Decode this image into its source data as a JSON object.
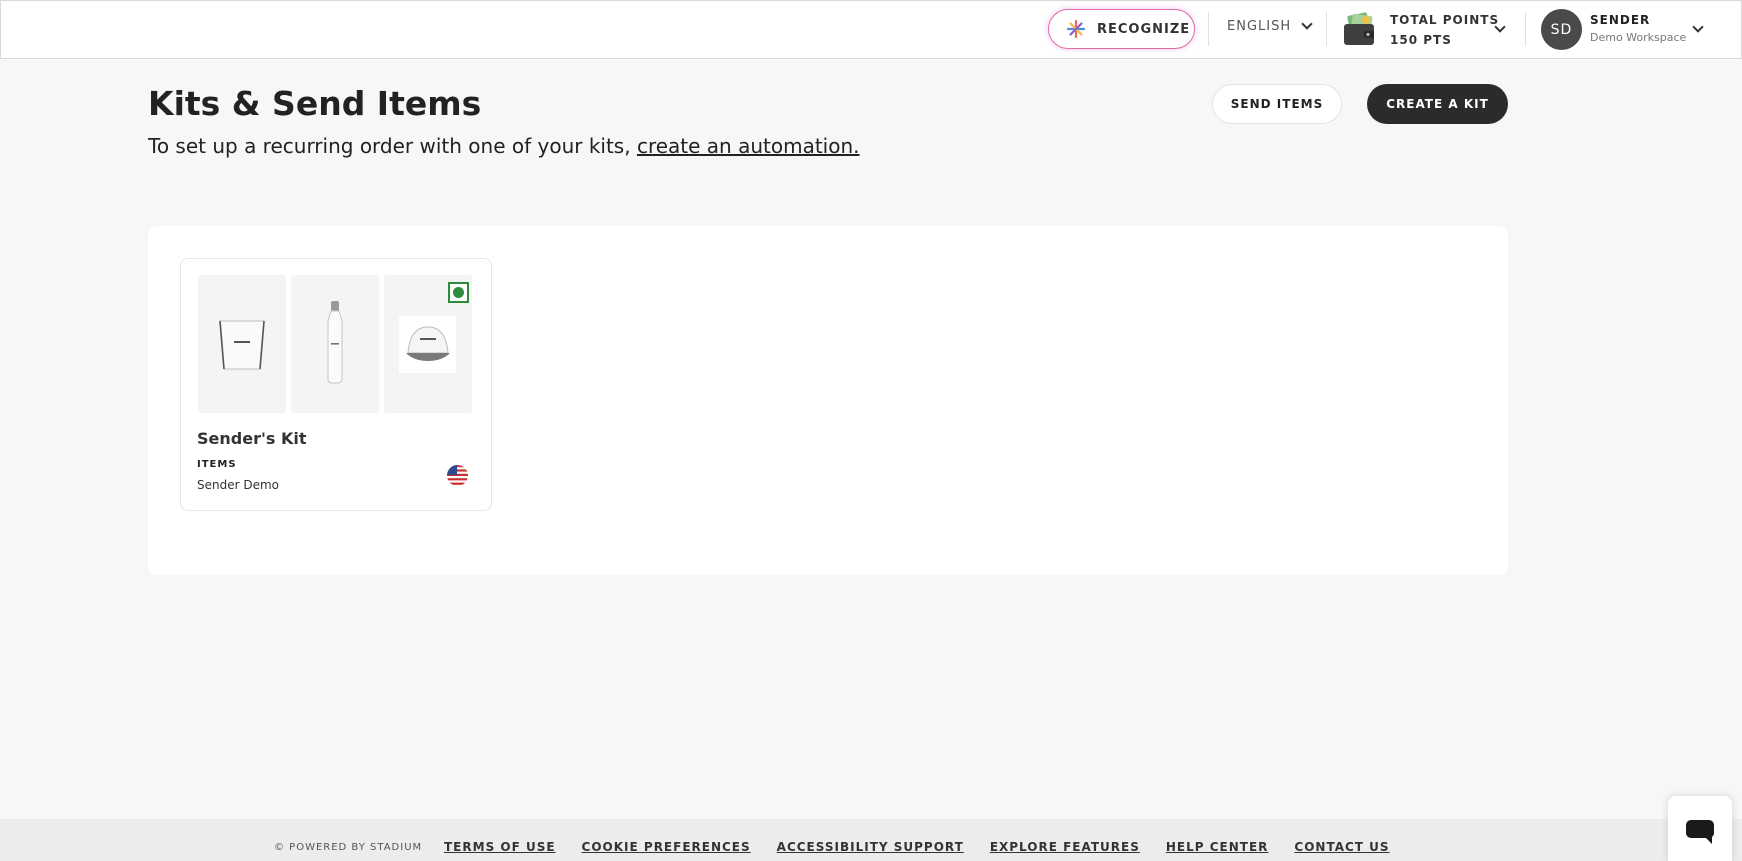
{
  "topbar": {
    "recognize_label": "RECOGNIZE",
    "language": "ENGLISH",
    "points_title": "TOTAL POINTS",
    "points_value": "150 PTS",
    "avatar_initials": "SD",
    "user_name": "SENDER",
    "workspace": "Demo Workspace"
  },
  "page": {
    "title": "Kits & Send Items",
    "subtitle_prefix": "To set up a recurring order with one of your kits,",
    "subtitle_link": "create an automation.",
    "send_items_label": "SEND ITEMS",
    "create_kit_label": "CREATE A KIT"
  },
  "kits": [
    {
      "name": "Sender's Kit",
      "items_label": "ITEMS",
      "owner": "Sender Demo",
      "selected": true
    }
  ],
  "footer": {
    "powered": "© POWERED BY STADIUM",
    "links": [
      "TERMS OF USE",
      "COOKIE PREFERENCES",
      "ACCESSIBILITY SUPPORT",
      "EXPLORE FEATURES",
      "HELP CENTER",
      "CONTACT US"
    ]
  },
  "colors": {
    "accent_dark": "#2b2b2b",
    "recognize_border": "#e46d9c",
    "selected_green": "#2e8b3d",
    "page_bg": "#f6f7f6"
  },
  "icons": [
    "recognize-spark-icon",
    "chevron-down-icon",
    "wallet-icon",
    "us-flag-icon",
    "chat-icon"
  ]
}
